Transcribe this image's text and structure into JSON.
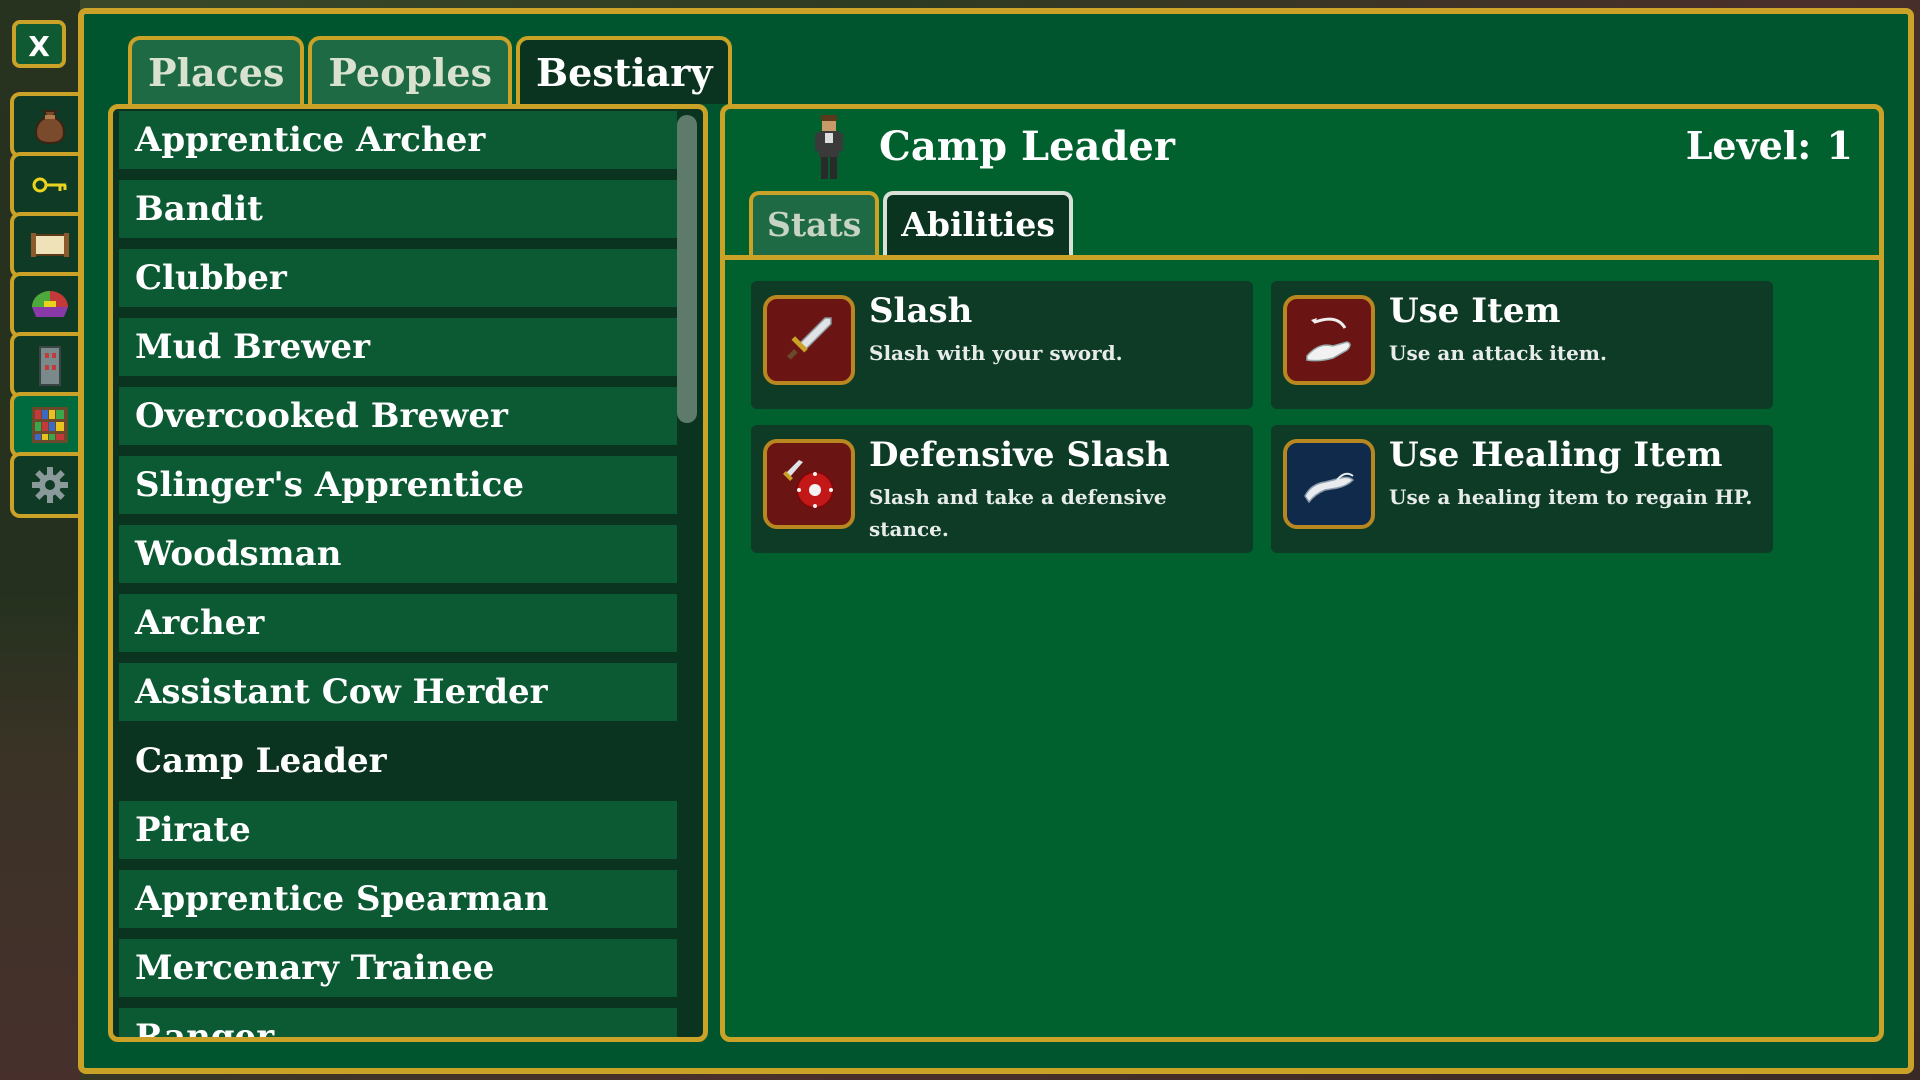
{
  "close_label": "X",
  "side_tabs": [
    {
      "name": "inventory-bag-icon",
      "active": false
    },
    {
      "name": "key-icon",
      "active": false
    },
    {
      "name": "scroll-icon",
      "active": false
    },
    {
      "name": "party-icon",
      "active": false
    },
    {
      "name": "tower-icon",
      "active": false
    },
    {
      "name": "bookshelf-icon",
      "active": true
    },
    {
      "name": "gear-icon",
      "active": false
    }
  ],
  "top_tabs": [
    {
      "label": "Places",
      "active": false
    },
    {
      "label": "Peoples",
      "active": false
    },
    {
      "label": "Bestiary",
      "active": true
    }
  ],
  "bestiary_list": [
    "Apprentice Archer",
    "Bandit",
    "Clubber",
    "Mud Brewer",
    "Overcooked Brewer",
    "Slinger's Apprentice",
    "Woodsman",
    "Archer",
    "Assistant Cow Herder",
    "Camp Leader",
    "Pirate",
    "Apprentice Spearman",
    "Mercenary Trainee",
    "Ranger"
  ],
  "selected_entry": "Camp Leader",
  "detail": {
    "name": "Camp Leader",
    "level_label": "Level:",
    "level_value": "1",
    "sub_tabs": [
      {
        "label": "Stats",
        "active": false
      },
      {
        "label": "Abilities",
        "active": true
      }
    ],
    "abilities": [
      {
        "title": "Slash",
        "desc": "Slash with your sword.",
        "icon": "sword-icon",
        "icon_bg": "#6b1414"
      },
      {
        "title": "Use Item",
        "desc": "Use an attack item.",
        "icon": "hand-throw-icon",
        "icon_bg": "#6b1414"
      },
      {
        "title": "Defensive Slash",
        "desc": "Slash and take a defensive stance.",
        "icon": "sword-shield-icon",
        "icon_bg": "#6b1414"
      },
      {
        "title": "Use Healing Item",
        "desc": "Use a healing item to regain HP.",
        "icon": "hand-heal-icon",
        "icon_bg": "#0f2a4a"
      }
    ]
  },
  "colors": {
    "frame_gold": "#c9a227",
    "panel_green": "#00552f",
    "selected_row": "#0b3420",
    "row_green": "#0c5a33"
  }
}
